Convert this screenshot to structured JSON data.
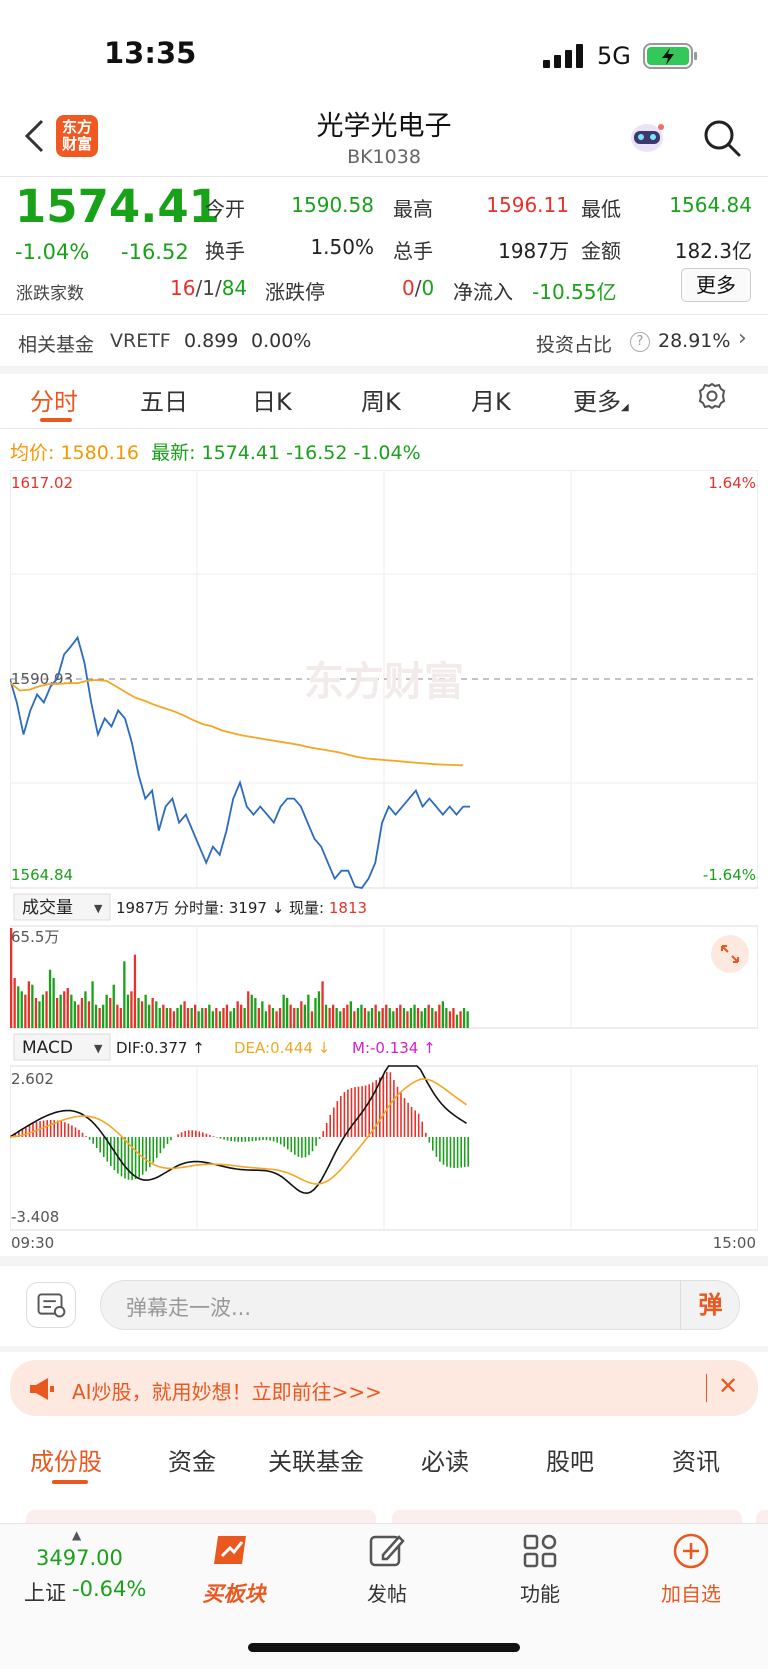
{
  "status_bar": {
    "time": "13:35",
    "network": "5G"
  },
  "nav": {
    "logo_line1": "东方",
    "logo_line2": "财富",
    "title": "光学光电子",
    "code": "BK1038"
  },
  "quote": {
    "price": "1574.41",
    "change_pct": "-1.04%",
    "change": "-16.52",
    "open_label": "今开",
    "open": "1590.58",
    "high_label": "最高",
    "high": "1596.11",
    "low_label": "最低",
    "low": "1564.84",
    "turnover_label": "换手",
    "turnover": "1.50%",
    "volume_label": "总手",
    "volume": "1987万",
    "amount_label": "金额",
    "amount": "182.3亿",
    "breadth_label": "涨跌家数",
    "up_count": "16",
    "flat_count": "1",
    "down_count": "84",
    "limit_label": "涨跌停",
    "limit_up": "0",
    "limit_down": "0",
    "netflow_label": "净流入",
    "netflow": "-10.55亿",
    "more_label": "更多"
  },
  "fund": {
    "label": "相关基金",
    "name": "VRETF",
    "price": "0.899",
    "change": "0.00%",
    "invest_label": "投资占比",
    "help": "?",
    "invest_value": "28.91%"
  },
  "tabs": [
    "分时",
    "五日",
    "日K",
    "周K",
    "月K",
    "更多"
  ],
  "info_line": {
    "avg_label": "均价:",
    "avg": "1580.16",
    "latest_label": "最新:",
    "latest": "1574.41",
    "change": "-16.52",
    "pct": "-1.04%"
  },
  "chart_labels": {
    "top_price": "1617.02",
    "top_pct": "1.64%",
    "mid_price": "1590.93",
    "bottom_price": "1564.84",
    "bottom_pct": "-1.64%",
    "watermark": "东方财富",
    "volume_selector": "成交量",
    "volume_info": "1987万 分时量: 3197 ↓ 现量: ",
    "volume_now": "1813",
    "volume_max": "65.5万",
    "macd_selector": "MACD",
    "dif": "DIF:0.377 ↑",
    "dea": "DEA:0.444 ↓",
    "m": "M:-0.134 ↑",
    "macd_top": "2.602",
    "macd_bottom": "-3.408",
    "time_start": "09:30",
    "time_end": "15:00"
  },
  "chart_data": {
    "type": "line",
    "x_range": [
      "09:30",
      "15:00"
    ],
    "ylim": [
      1564.84,
      1617.02
    ],
    "reference": 1590.93,
    "series": [
      {
        "name": "price",
        "values": [
          1590.9,
          1588,
          1584,
          1587,
          1589,
          1588,
          1590,
          1591,
          1594,
          1595,
          1596.1,
          1593,
          1588,
          1584,
          1586,
          1585,
          1587,
          1586,
          1583,
          1579,
          1576,
          1577,
          1572,
          1575,
          1576,
          1573,
          1574,
          1572,
          1570,
          1568,
          1570,
          1569,
          1572,
          1576,
          1578,
          1575,
          1574,
          1575,
          1574,
          1573,
          1575,
          1576,
          1576,
          1575,
          1573,
          1571,
          1570,
          1568,
          1566,
          1567,
          1567,
          1565,
          1564.84,
          1566,
          1568,
          1573,
          1575,
          1574,
          1575,
          1576,
          1577,
          1575,
          1576,
          1575,
          1574,
          1575,
          1574,
          1575,
          1575
        ],
        "color": "#2a6ac0"
      },
      {
        "name": "avg",
        "values": [
          1590.5,
          1589.5,
          1589.6,
          1590,
          1590.3,
          1590.3,
          1590.4,
          1590.4,
          1590.7,
          1590.8,
          1590.7,
          1590,
          1589.3,
          1588.6,
          1588.2,
          1587.7,
          1587.3,
          1586.9,
          1586.4,
          1585.8,
          1585.3,
          1585,
          1584.5,
          1584.2,
          1583.9,
          1583.7,
          1583.5,
          1583.3,
          1583.1,
          1582.9,
          1582.7,
          1582.4,
          1582.2,
          1582,
          1581.8,
          1581.5,
          1581.2,
          1581,
          1580.9,
          1580.8,
          1580.7,
          1580.6,
          1580.5,
          1580.4,
          1580.3,
          1580.25,
          1580.2,
          1580.16
        ],
        "color": "#f5a623"
      }
    ],
    "volume": [
      60,
      30,
      25,
      22,
      20,
      28,
      26,
      18,
      16,
      20,
      22,
      35,
      30,
      18,
      20,
      22,
      24,
      20,
      16,
      14,
      18,
      22,
      16,
      28,
      14,
      12,
      14,
      20,
      18,
      26,
      14,
      12,
      40,
      20,
      22,
      44,
      18,
      16,
      20,
      14,
      18,
      16,
      12,
      14,
      12,
      12,
      10,
      12,
      14,
      16,
      12,
      12,
      14,
      10,
      12,
      12,
      14,
      10,
      12,
      10,
      12,
      14,
      10,
      12,
      16,
      14,
      12,
      22,
      20,
      18,
      12,
      16,
      10,
      14,
      12,
      10,
      12,
      20,
      18,
      14,
      12,
      12,
      16,
      14,
      20,
      10,
      18,
      22,
      28,
      14,
      12,
      14,
      12,
      10,
      12,
      14,
      16,
      10,
      12,
      14,
      12,
      10,
      12,
      14,
      10,
      12,
      14,
      12,
      10,
      12,
      14,
      12,
      10,
      12,
      14,
      12,
      10,
      12,
      14,
      12,
      10,
      14,
      16,
      12,
      10,
      12,
      8,
      10,
      12,
      10
    ],
    "macd": {
      "dif": 0.377,
      "dea": 0.444,
      "m": -0.134,
      "range": [
        -3.408,
        2.602
      ]
    }
  },
  "danmu": {
    "placeholder": "弹幕走一波...",
    "button": "弹"
  },
  "ai_banner": {
    "text": "AI炒股，就用妙想！立即前往>>>",
    "close": "✕"
  },
  "bottom_tabs": [
    "成份股",
    "资金",
    "关联基金",
    "必读",
    "股吧",
    "资讯"
  ],
  "bottom_nav": {
    "index_value": "3497.00",
    "index_name": "上证",
    "index_pct": "-0.64%",
    "buy": "买板块",
    "post": "发帖",
    "func": "功能",
    "add": "加自选"
  },
  "colors": {
    "accent": "#e8581f",
    "up": "#e8312a",
    "down": "#1aa11a",
    "price_line": "#2a6ac0",
    "avg_line": "#f5a623"
  }
}
